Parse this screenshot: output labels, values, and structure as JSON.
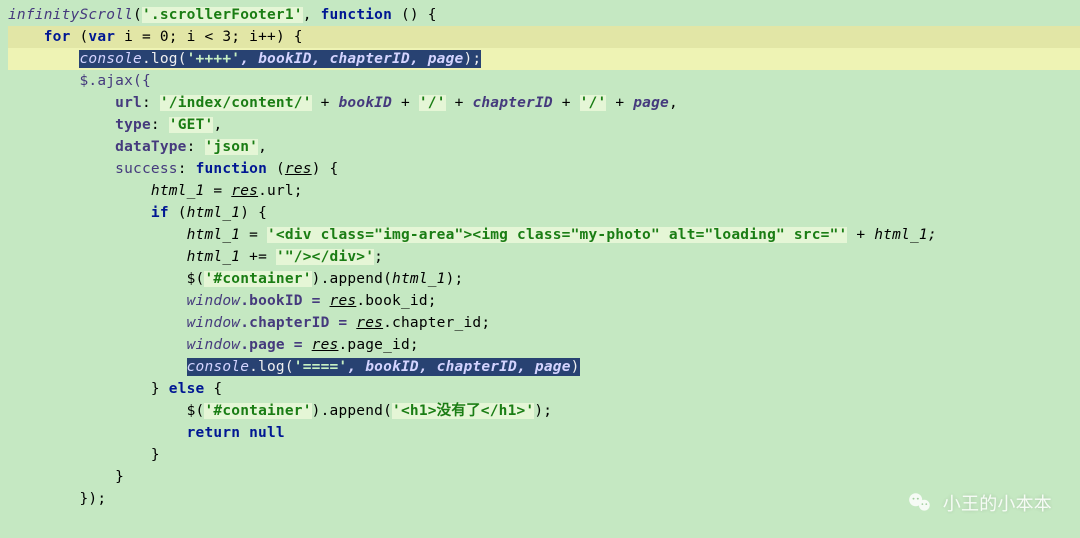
{
  "code": {
    "line01": {
      "fn": "infinityScroll",
      "arg": "'.scrollerFooter1'",
      "kw": "function",
      "tail": " () {"
    },
    "line02": {
      "for": "for",
      "var": "var",
      "init": " i = 0; i < 3; i++) {"
    },
    "line03": {
      "obj": "console",
      "method": ".log(",
      "arg": "'++++'",
      "ids": ", bookID, chapterID, page",
      "end": ");"
    },
    "line04": "$.ajax({",
    "line05": {
      "key": "url",
      "parts": [
        "'/index/content/'",
        " + ",
        "bookID",
        " + ",
        "'/'",
        " + ",
        "chapterID",
        " + ",
        "'/'",
        " + ",
        "page",
        ","
      ]
    },
    "line06": {
      "key": "type",
      "val": "'GET'",
      "end": ","
    },
    "line07": {
      "key": "dataType",
      "val": "'json'",
      "end": ","
    },
    "line08": {
      "key": "success",
      "kw": "function",
      "arg": "res",
      "end": ") {"
    },
    "line09": {
      "lhs": "html_1",
      "rhs": "res",
      "prop": ".url;"
    },
    "line10": {
      "kw": "if",
      "cond": "html_1",
      "end": ") {"
    },
    "line11": {
      "lhs": "html_1",
      "str": "'<div class=\"img-area\"><img class=\"my-photo\" alt=\"loading\" src=\"'",
      "plus": " + ",
      "rhs": "html_1;"
    },
    "line12": {
      "lhs": "html_1",
      "op": " += ",
      "str": "'\"/></div>'",
      "end": ";"
    },
    "line13": {
      "call": "$(",
      "sel": "'#container'",
      "method": ").append(",
      "arg": "html_1",
      "end": ");"
    },
    "line14": {
      "win": "window",
      "prop": ".bookID = ",
      "res": "res",
      "tail": ".book_id;"
    },
    "line15": {
      "win": "window",
      "prop": ".chapterID = ",
      "res": "res",
      "tail": ".chapter_id;"
    },
    "line16": {
      "win": "window",
      "prop": ".page = ",
      "res": "res",
      "tail": ".page_id;"
    },
    "line17": {
      "obj": "console",
      "method": ".log(",
      "arg": "'===='",
      "ids": ", bookID, chapterID, page",
      "end": ")"
    },
    "line18": {
      "close": "}",
      "kw": "else",
      "open": " {"
    },
    "line19": {
      "call": "$(",
      "sel": "'#container'",
      "method": ").append(",
      "str": "'<h1>没有了</h1>'",
      "end": ");"
    },
    "line20": {
      "kw": "return null"
    },
    "line21": "}",
    "line22": "}",
    "line23": "});"
  },
  "watermark": "小王的小本本"
}
